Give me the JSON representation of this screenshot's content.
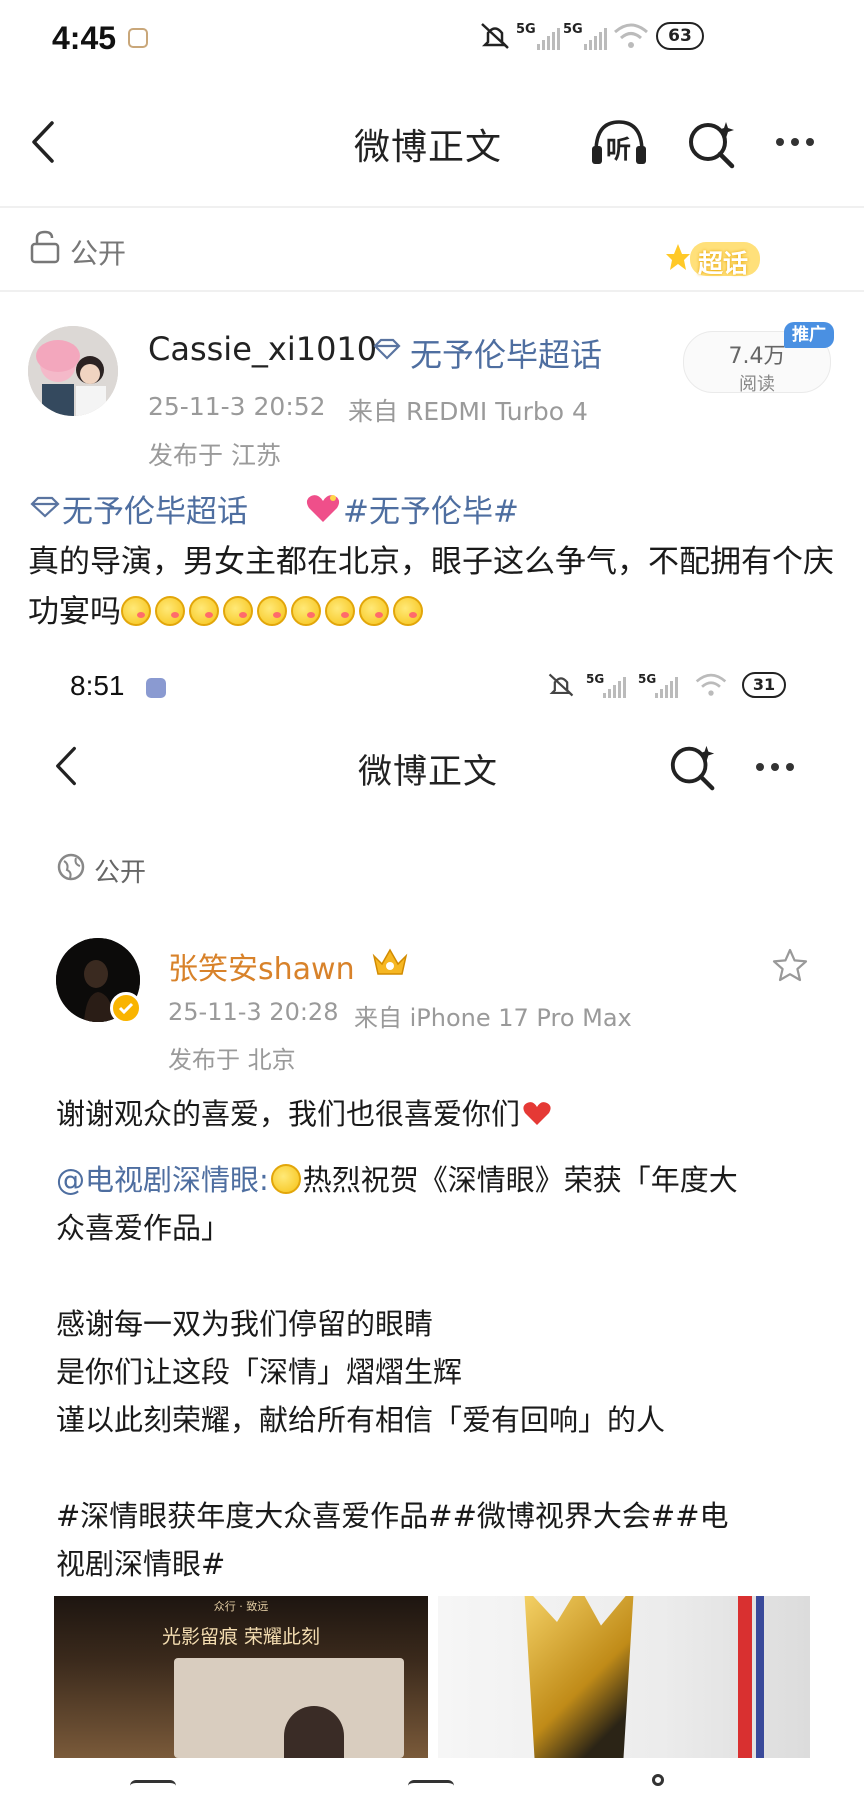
{
  "status_top": {
    "time": "4:45",
    "net1": "5G",
    "net2": "5G",
    "battery": "63"
  },
  "header_top": {
    "title": "微博正文",
    "listen_label": "听"
  },
  "visibility_top": {
    "label": "公开",
    "badge": "超话"
  },
  "post_top": {
    "username": "Cassie_xi1010",
    "supertopic": "无予伦毕超话",
    "timestamp": "25-11-3 20:52",
    "source": "来自 REDMI Turbo 4",
    "location": "发布于 江苏",
    "read_count": "7.4万",
    "read_label": "阅读",
    "promo_badge": "推广",
    "topic_link": "无予伦毕超话",
    "hashtag": "#无予伦毕#",
    "text": "真的导演，男女主都在北京，眼子这么争气，不配拥有个庆功宴吗"
  },
  "status_inner": {
    "time": "8:51",
    "net1": "5G",
    "net2": "5G",
    "battery": "31"
  },
  "header_inner": {
    "title": "微博正文"
  },
  "visibility_inner": {
    "label": "公开"
  },
  "post_inner": {
    "username": "张笑安shawn",
    "timestamp": "25-11-3 20:28",
    "source": "来自 iPhone 17 Pro Max",
    "location": "发布于 北京",
    "text": "谢谢观众的喜爱，我们也很喜爱你们",
    "mention": "@电视剧深情眼:",
    "repost_line1": "热烈祝贺《深情眼》荣获「年度大",
    "repost_line2": "众喜爱作品」",
    "para1": "感谢每一双为我们停留的眼睛",
    "para2": "是你们让这段「深情」熠熠生辉",
    "para3": "谨以此刻荣耀，献给所有相信「爱有回响」的人",
    "hashtags_line1": "#深情眼获年度大众喜爱作品##微博视界大会##电",
    "hashtags_line2": "视剧深情眼#",
    "image1_caption_top": "众行 · 致远",
    "image1_caption": "光影留痕  荣耀此刻"
  },
  "colors": {
    "link": "#4e6ea0",
    "vip_name": "#d8822a",
    "heart": "#e53935",
    "promo": "#4a90e2"
  }
}
